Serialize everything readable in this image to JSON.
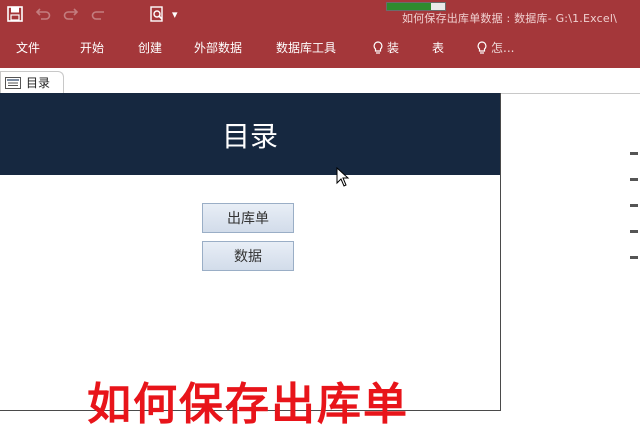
{
  "window": {
    "title": "如何保存出库单数据 : 数据库- G:\\1.Excel\\"
  },
  "quick_access": {
    "icons": [
      "save-icon",
      "undo-icon",
      "redo-icon",
      "print-preview-icon"
    ],
    "progress_fraction": 0.75
  },
  "ribbon": {
    "tabs": [
      {
        "label": "文件"
      },
      {
        "label": "开始"
      },
      {
        "label": "创建"
      },
      {
        "label": "外部数据"
      },
      {
        "label": "数据库工具"
      },
      {
        "label": "装"
      },
      {
        "label": "表"
      },
      {
        "label": "怎..."
      }
    ]
  },
  "document_tab": {
    "label": "目录"
  },
  "form": {
    "title": "目录",
    "buttons": [
      {
        "label": "出库单"
      },
      {
        "label": "数据"
      }
    ]
  },
  "overlay_caption": "如何保存出库单",
  "colors": {
    "ribbon": "#a4373a",
    "form_header": "#162840",
    "caption": "#e8141a"
  }
}
